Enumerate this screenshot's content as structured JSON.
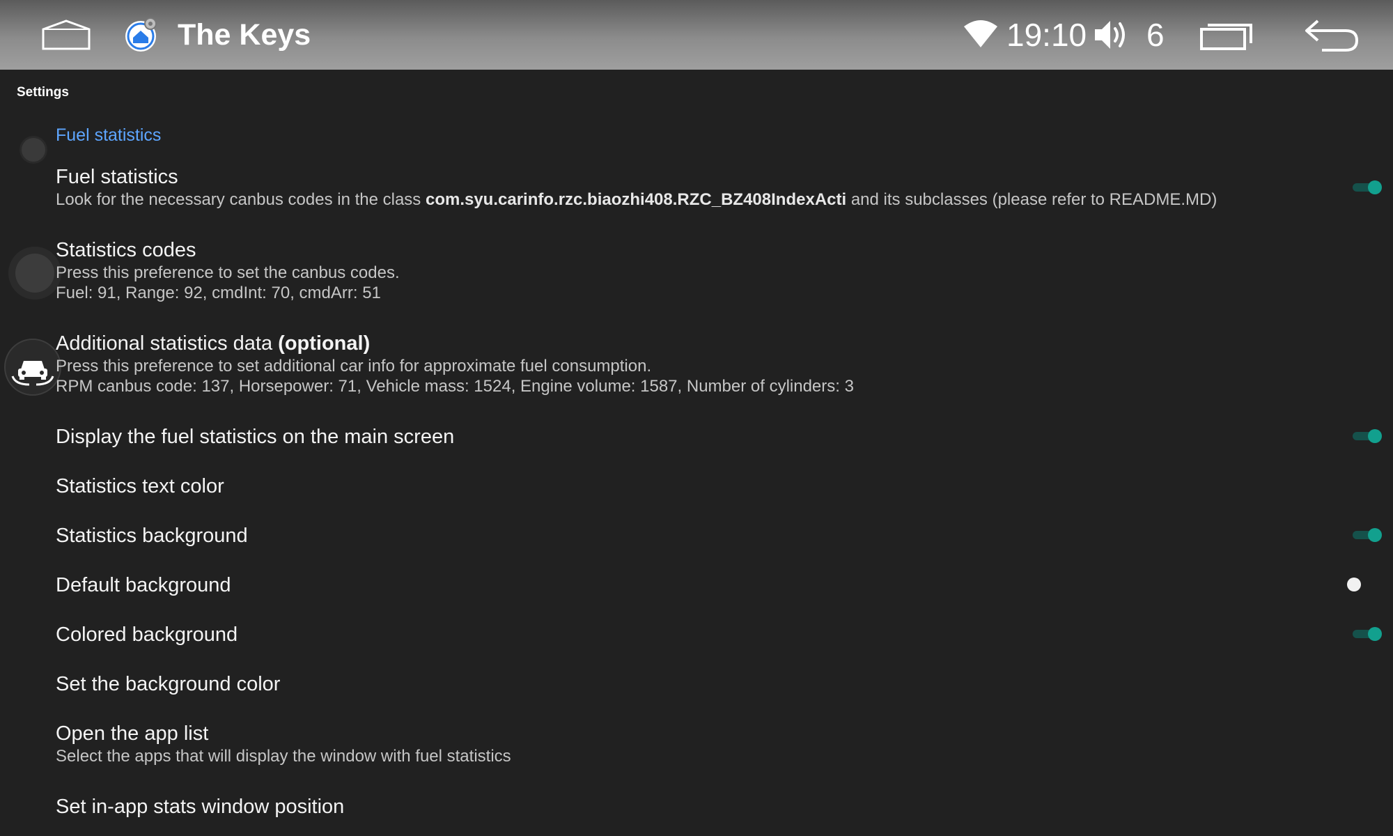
{
  "statusbar": {
    "app_title": "The Keys",
    "clock": "19:10",
    "volume_level": "6",
    "icons": [
      "home-icon",
      "app-logo-icon",
      "wifi-icon",
      "volume-icon",
      "recents-icon",
      "back-icon"
    ]
  },
  "breadcrumb": "Settings",
  "category": "Fuel statistics",
  "colors": {
    "background": "#212121",
    "accent_category": "#5ea6ff",
    "switch_on": "#12a08e",
    "switch_track": "#15514b",
    "switch_off_thumb": "#f1f1f1"
  },
  "prefs": [
    {
      "title": "Fuel statistics",
      "summary_pre": "Look for the necessary canbus codes in the class ",
      "summary_bold": "com.syu.carinfo.rzc.biaozhi408.RZC_BZ408IndexActi",
      "summary_post": " and its subclasses (please refer to README.MD)",
      "switch_on": true
    },
    {
      "title": "Statistics codes",
      "summary_line1": "Press this preference to set the canbus codes.",
      "summary_line2": "Fuel: 91, Range: 92, cmdInt: 70, cmdArr: 51"
    },
    {
      "title": "Additional statistics data ",
      "title_bold": "(optional)",
      "summary_line1": "Press this preference to set additional car info for approximate fuel consumption.",
      "summary_line2": "RPM canbus code: 137, Horsepower: 71, Vehicle mass: 1524, Engine volume: 1587, Number of cylinders: 3"
    },
    {
      "title": "Display the fuel statistics on the main screen",
      "switch_on": true
    },
    {
      "title": "Statistics text color"
    },
    {
      "title": "Statistics background",
      "switch_on": true
    },
    {
      "title": "Default background",
      "switch_on": false
    },
    {
      "title": "Colored background",
      "switch_on": true
    },
    {
      "title": "Set the background color"
    },
    {
      "title": "Open the app list",
      "summary_line1": "Select the apps that will display the window with fuel statistics"
    },
    {
      "title": "Set in-app stats window position"
    }
  ]
}
